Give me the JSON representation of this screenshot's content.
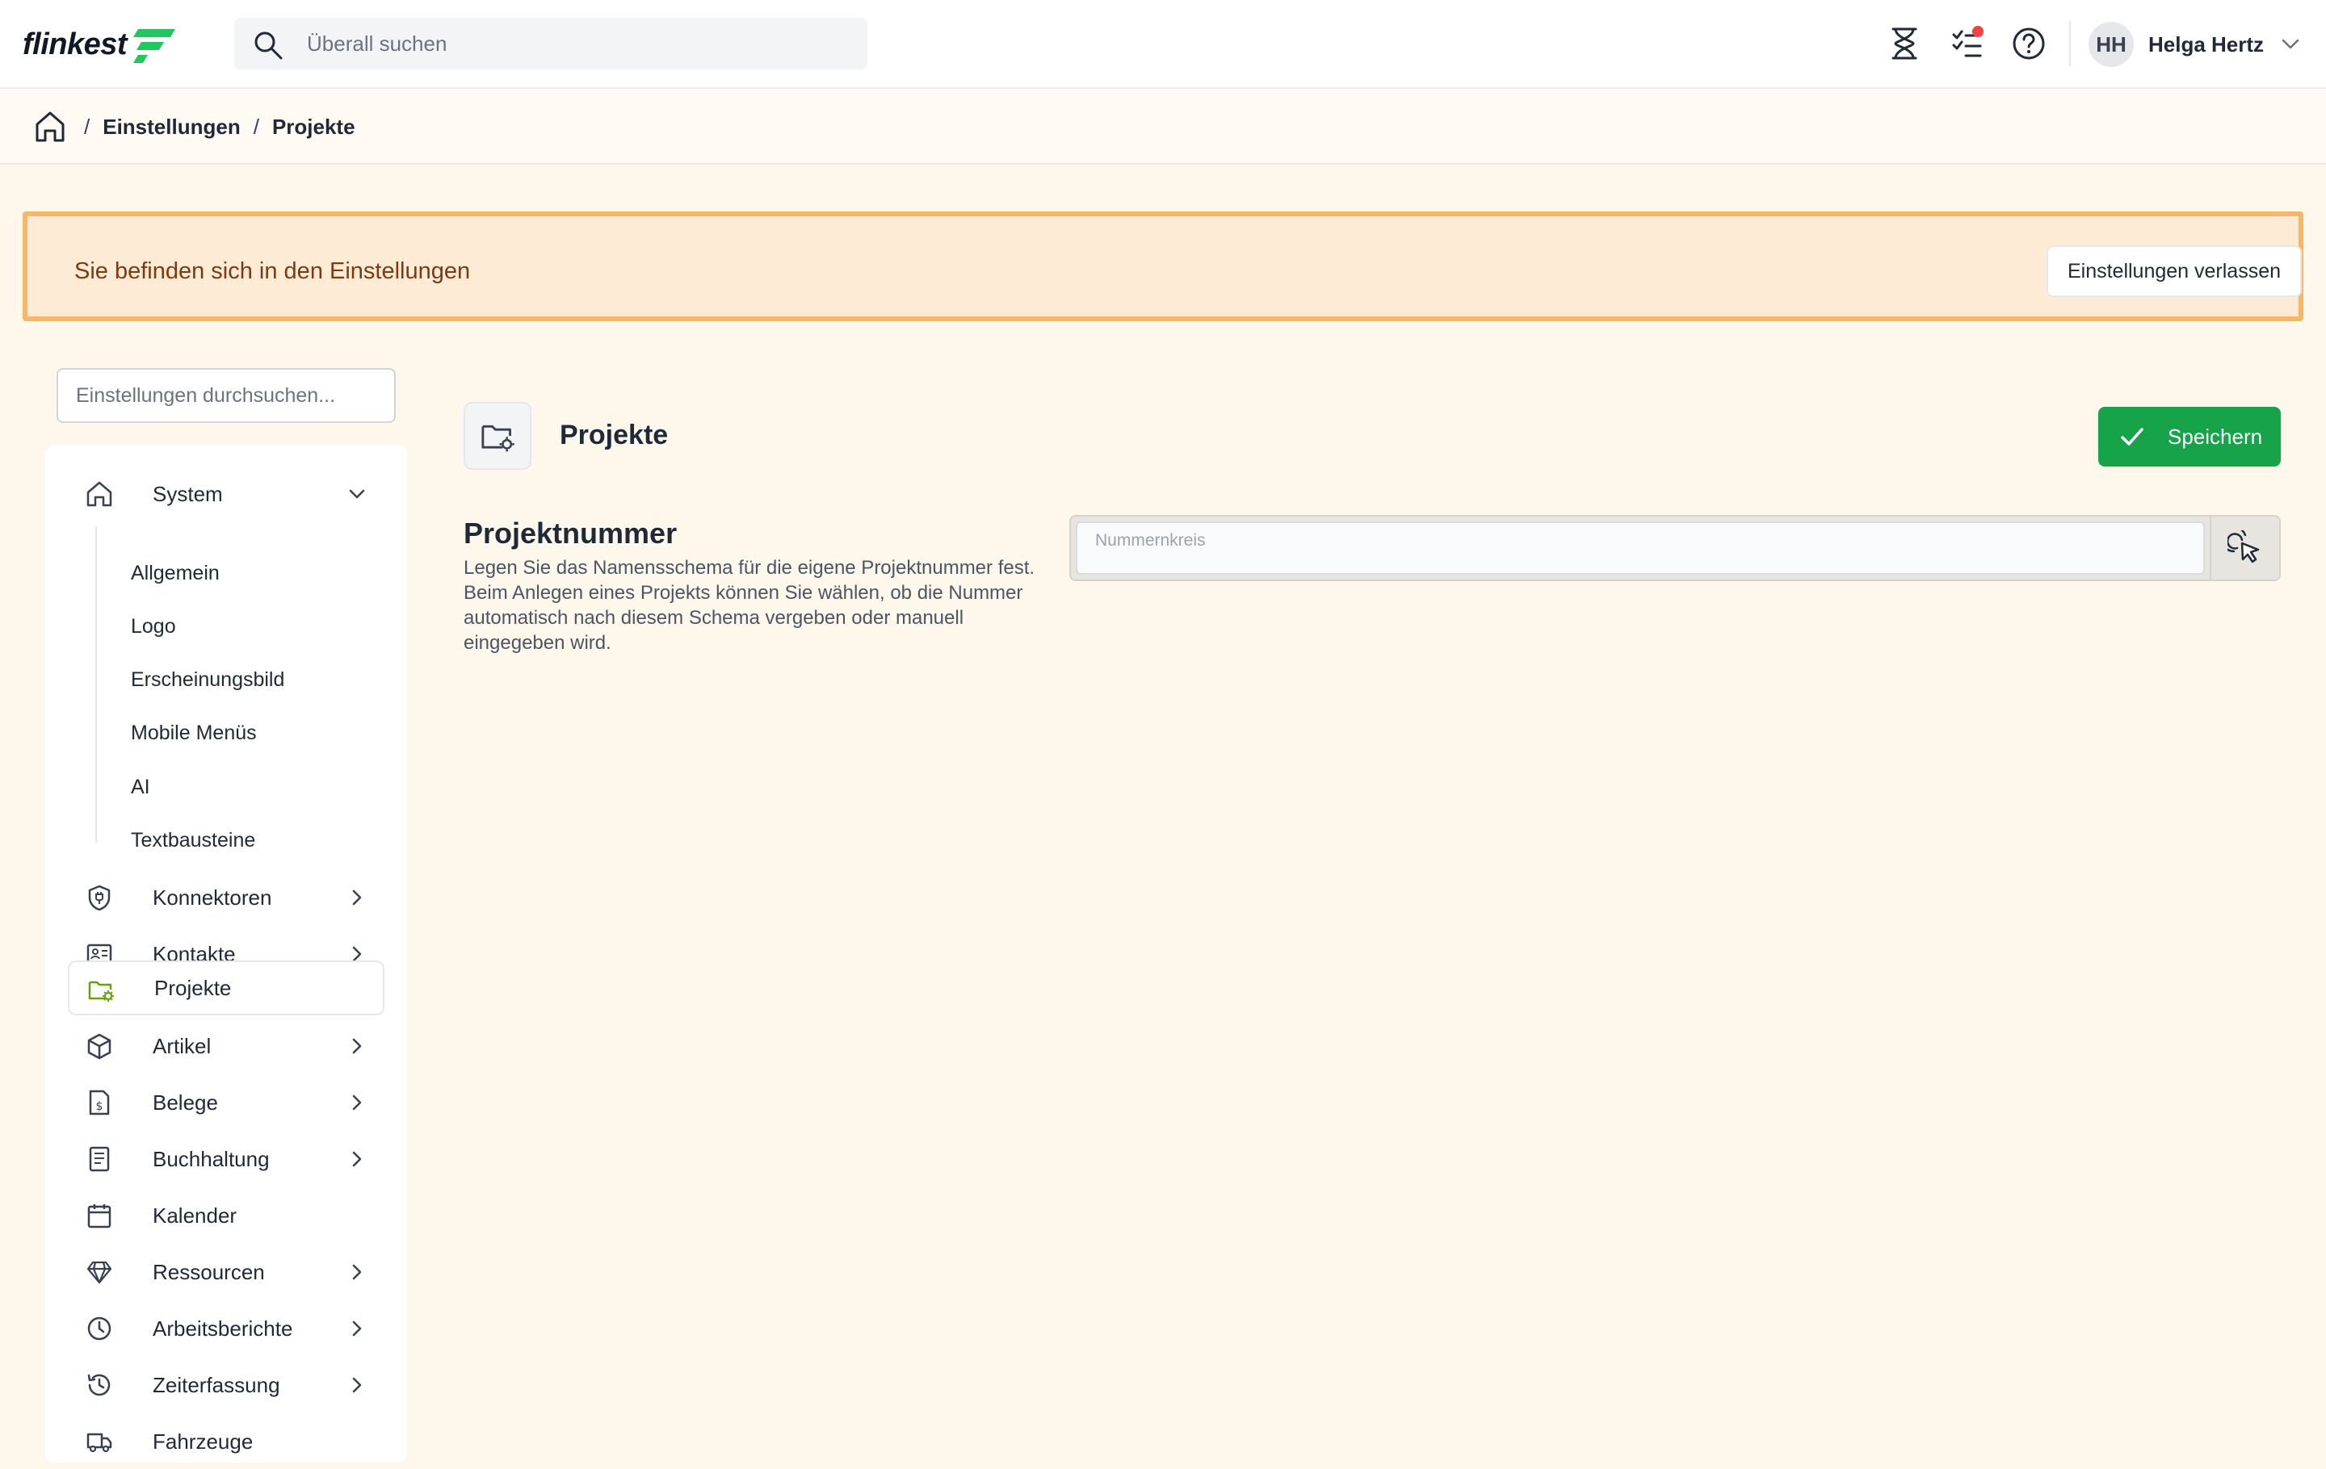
{
  "header": {
    "logo_text": "flinkest",
    "search_placeholder": "Überall suchen",
    "icons": [
      "hourglass-icon",
      "tasks-icon",
      "help-icon"
    ],
    "user": {
      "initials": "HH",
      "name": "Helga Hertz"
    }
  },
  "breadcrumb": {
    "items": [
      "Einstellungen",
      "Projekte"
    ],
    "separator": "/"
  },
  "banner": {
    "text": "Sie befinden sich in den Einstellungen",
    "button_label": "Einstellungen verlassen"
  },
  "sidebar": {
    "search_placeholder": "Einstellungen durchsuchen...",
    "system_label": "System",
    "system_children": [
      "Allgemein",
      "Logo",
      "Erscheinungsbild",
      "Mobile Menüs",
      "AI",
      "Textbausteine"
    ],
    "items": [
      {
        "label": "Konnektoren",
        "icon": "plug-shield-icon",
        "expandable": true
      },
      {
        "label": "Kontakte",
        "icon": "contact-card-icon",
        "expandable": true
      },
      {
        "label": "Projekte",
        "icon": "folder-gear-icon",
        "expandable": false,
        "active": true
      },
      {
        "label": "Artikel",
        "icon": "box-icon",
        "expandable": true
      },
      {
        "label": "Belege",
        "icon": "receipt-icon",
        "expandable": true
      },
      {
        "label": "Buchhaltung",
        "icon": "ledger-icon",
        "expandable": true
      },
      {
        "label": "Kalender",
        "icon": "calendar-icon",
        "expandable": false
      },
      {
        "label": "Ressourcen",
        "icon": "diamond-icon",
        "expandable": true
      },
      {
        "label": "Arbeitsberichte",
        "icon": "clock-icon",
        "expandable": true
      },
      {
        "label": "Zeiterfassung",
        "icon": "history-icon",
        "expandable": true
      },
      {
        "label": "Fahrzeuge",
        "icon": "truck-icon",
        "expandable": false
      }
    ]
  },
  "main": {
    "page_title": "Projekte",
    "save_label": "Speichern",
    "section": {
      "title": "Projektnummer",
      "description": "Legen Sie das Namensschema für die eigene Projektnummer fest. Beim Anlegen eines Projekts können Sie wählen, ob die Nummer automatisch nach diesem Schema vergeben oder manuell eingegeben wird.",
      "field_label": "Nummernkreis",
      "field_value": ""
    }
  },
  "colors": {
    "accent_green": "#16a34a",
    "banner_bg": "#feebd5",
    "banner_border": "#f6b769",
    "page_bg": "#fef7ec",
    "notification_dot": "#ef4444"
  }
}
